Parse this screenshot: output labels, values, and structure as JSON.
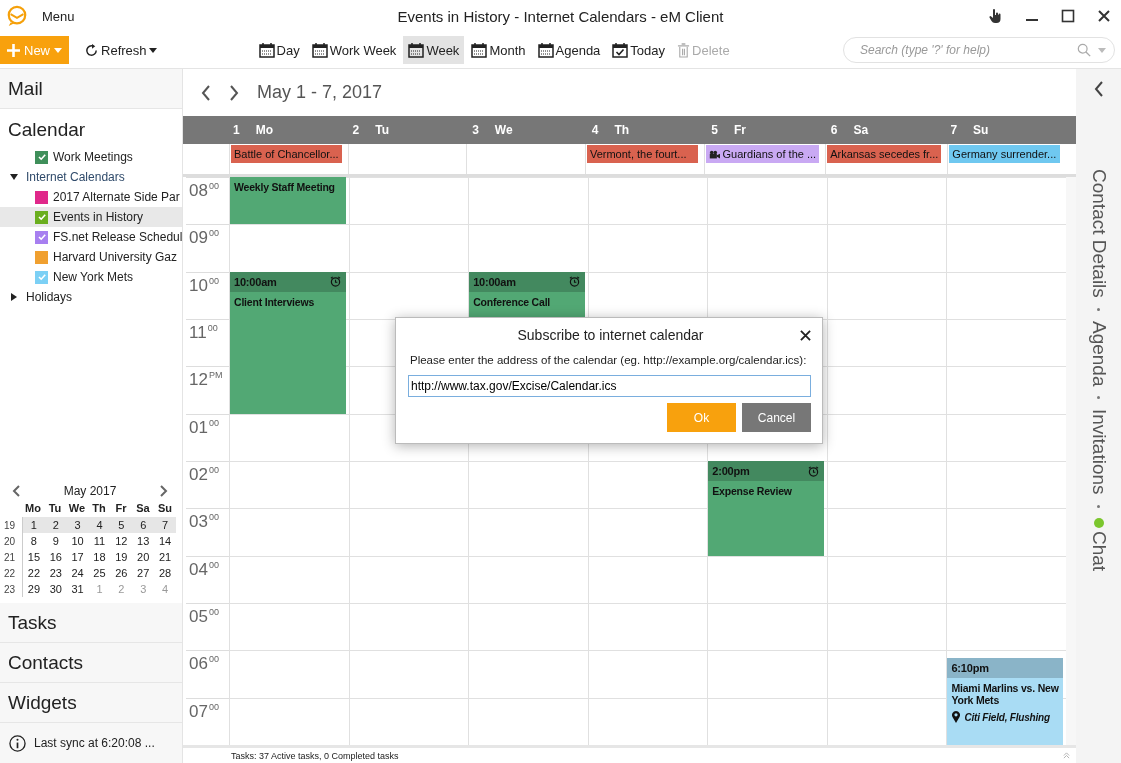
{
  "window": {
    "menu": "Menu",
    "title": "Events in History - Internet Calendars - eM Client"
  },
  "toolbar": {
    "new": "New",
    "refresh": "Refresh",
    "items": [
      {
        "label": "Day",
        "kind": "view",
        "selected": false,
        "disabled": false
      },
      {
        "label": "Work Week",
        "kind": "view",
        "selected": false,
        "disabled": false
      },
      {
        "label": "Week",
        "kind": "view",
        "selected": true,
        "disabled": false
      },
      {
        "label": "Month",
        "kind": "view",
        "selected": false,
        "disabled": false
      },
      {
        "label": "Agenda",
        "kind": "view",
        "selected": false,
        "disabled": false
      },
      {
        "label": "Today",
        "kind": "today",
        "selected": false,
        "disabled": false
      },
      {
        "label": "Delete",
        "kind": "delete",
        "selected": false,
        "disabled": true
      }
    ],
    "search": {
      "placeholder": "Search (type '?' for help)"
    }
  },
  "sidebar": {
    "top": "Mail",
    "section": "Calendar",
    "tree": [
      {
        "label": "Work Meetings",
        "color": "#3f8f5a",
        "checked": true,
        "selected": false
      },
      {
        "label": "Internet Calendars",
        "expanded": true,
        "children": [
          {
            "label": "2017 Alternate Side Par",
            "color": "#e0288a",
            "checked": false,
            "selected": false
          },
          {
            "label": "Events in History",
            "color": "#6aae1e",
            "checked": true,
            "selected": true
          },
          {
            "label": "FS.net Release Schedul",
            "color": "#a77ff0",
            "checked": true,
            "selected": false
          },
          {
            "label": "Harvard University Gaz",
            "color": "#f0a030",
            "checked": false,
            "selected": false
          },
          {
            "label": "New York Mets",
            "color": "#7cd0f5",
            "checked": true,
            "selected": false
          }
        ]
      },
      {
        "label": "Holidays",
        "expanded": false
      }
    ],
    "mini_calendar": {
      "title": "May 2017",
      "weekdays": [
        "Mo",
        "Tu",
        "We",
        "Th",
        "Fr",
        "Sa",
        "Su"
      ],
      "weeks": [
        {
          "num": "19",
          "selected": true,
          "days": [
            {
              "d": "1",
              "dimmed": false
            },
            {
              "d": "2",
              "dimmed": false
            },
            {
              "d": "3",
              "dimmed": false
            },
            {
              "d": "4",
              "dimmed": false
            },
            {
              "d": "5",
              "dimmed": false
            },
            {
              "d": "6",
              "dimmed": false
            },
            {
              "d": "7",
              "dimmed": false
            }
          ]
        },
        {
          "num": "20",
          "selected": false,
          "days": [
            {
              "d": "8",
              "dimmed": false
            },
            {
              "d": "9",
              "dimmed": false
            },
            {
              "d": "10",
              "dimmed": false
            },
            {
              "d": "11",
              "dimmed": false
            },
            {
              "d": "12",
              "dimmed": false
            },
            {
              "d": "13",
              "dimmed": false
            },
            {
              "d": "14",
              "dimmed": false
            }
          ]
        },
        {
          "num": "21",
          "selected": false,
          "days": [
            {
              "d": "15",
              "dimmed": false
            },
            {
              "d": "16",
              "dimmed": false
            },
            {
              "d": "17",
              "dimmed": false
            },
            {
              "d": "18",
              "dimmed": false
            },
            {
              "d": "19",
              "dimmed": false
            },
            {
              "d": "20",
              "dimmed": false
            },
            {
              "d": "21",
              "dimmed": false
            }
          ]
        },
        {
          "num": "22",
          "selected": false,
          "days": [
            {
              "d": "22",
              "dimmed": false
            },
            {
              "d": "23",
              "dimmed": false
            },
            {
              "d": "24",
              "dimmed": false
            },
            {
              "d": "25",
              "dimmed": false
            },
            {
              "d": "26",
              "dimmed": false
            },
            {
              "d": "27",
              "dimmed": false
            },
            {
              "d": "28",
              "dimmed": false
            }
          ]
        },
        {
          "num": "23",
          "selected": false,
          "days": [
            {
              "d": "29",
              "dimmed": false
            },
            {
              "d": "30",
              "dimmed": false
            },
            {
              "d": "31",
              "dimmed": false
            },
            {
              "d": "1",
              "dimmed": true
            },
            {
              "d": "2",
              "dimmed": true
            },
            {
              "d": "3",
              "dimmed": true
            },
            {
              "d": "4",
              "dimmed": true
            }
          ]
        }
      ]
    },
    "bottom": [
      "Tasks",
      "Contacts",
      "Widgets"
    ],
    "sync": "Last sync at 6:20:08 ..."
  },
  "calendar": {
    "range": "May 1 - 7, 2017",
    "hours": [
      {
        "label": "08",
        "suffix": "00"
      },
      {
        "label": "09",
        "suffix": "00"
      },
      {
        "label": "10",
        "suffix": "00"
      },
      {
        "label": "11",
        "suffix": "00"
      },
      {
        "label": "12",
        "suffix": "PM"
      },
      {
        "label": "01",
        "suffix": "00"
      },
      {
        "label": "02",
        "suffix": "00"
      },
      {
        "label": "03",
        "suffix": "00"
      },
      {
        "label": "04",
        "suffix": "00"
      },
      {
        "label": "05",
        "suffix": "00"
      },
      {
        "label": "06",
        "suffix": "00"
      },
      {
        "label": "07",
        "suffix": "00"
      }
    ],
    "days": [
      {
        "num": "1",
        "name": "Mo",
        "all_day": [
          {
            "title": "Battle of Chancellor...",
            "color": "#d9624f",
            "kind": "event"
          }
        ],
        "events": [
          {
            "title": "Weekly Staff Meeting",
            "color": "#52a874"
          },
          {
            "title": "Client Interviews",
            "time": "10:00am",
            "color": "#52a874",
            "alarm": true
          }
        ]
      },
      {
        "num": "2",
        "name": "Tu"
      },
      {
        "num": "3",
        "name": "We",
        "events": [
          {
            "title": "Conference Call",
            "time": "10:00am",
            "color": "#52a874",
            "alarm": true
          }
        ]
      },
      {
        "num": "4",
        "name": "Th",
        "all_day": [
          {
            "title": "Vermont, the fourt...",
            "color": "#d9624f",
            "kind": "event"
          }
        ]
      },
      {
        "num": "5",
        "name": "Fr",
        "all_day": [
          {
            "title": "Guardians of the ...",
            "color": "#c9a9f3",
            "kind": "movie"
          }
        ],
        "events": [
          {
            "title": "Expense Review",
            "time": "2:00pm",
            "color": "#52a874",
            "alarm": true
          }
        ]
      },
      {
        "num": "6",
        "name": "Sa",
        "all_day": [
          {
            "title": "Arkansas secedes fr...",
            "color": "#d9624f",
            "kind": "event"
          }
        ]
      },
      {
        "num": "7",
        "name": "Su",
        "all_day": [
          {
            "title": "Germany surrender...",
            "color": "#6fc8f0",
            "kind": "event"
          }
        ],
        "events": [
          {
            "title": "Miami Marlins vs. New York Mets",
            "time": "6:10pm",
            "color": "#a9dcf4",
            "location": "Citi Field, Flushing"
          }
        ]
      }
    ],
    "status": "Tasks: 37 Active tasks, 0 Completed tasks"
  },
  "right_pane": {
    "items": [
      {
        "label": "Contact Details"
      },
      {
        "label": "Agenda"
      },
      {
        "label": "Invitations"
      },
      {
        "label": "Chat",
        "online": true
      }
    ]
  },
  "dialog": {
    "title": "Subscribe to internet calendar",
    "prompt": "Please enter the address of the calendar (eg. http://example.org/calendar.ics):",
    "value": "http://www.tax.gov/Excise/Calendar.ics",
    "ok": "Ok",
    "cancel": "Cancel"
  }
}
